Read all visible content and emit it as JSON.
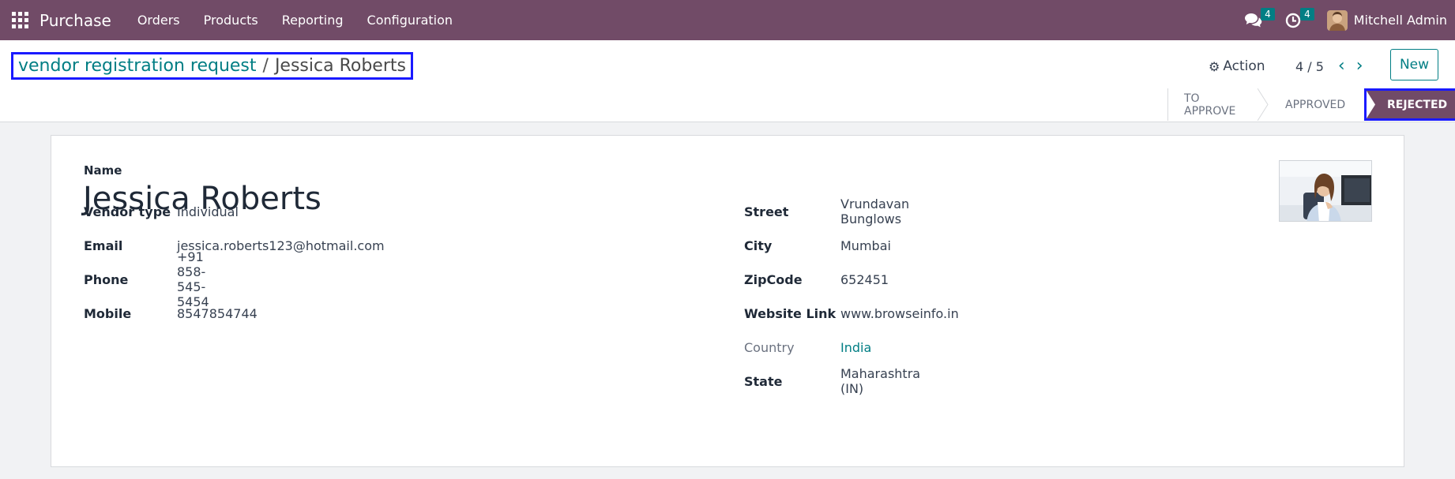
{
  "navbar": {
    "brand": "Purchase",
    "menu": [
      "Orders",
      "Products",
      "Reporting",
      "Configuration"
    ],
    "messages_count": "4",
    "activities_count": "4",
    "user_name": "Mitchell Admin"
  },
  "breadcrumb": {
    "parent": "vendor registration request",
    "separator": "/",
    "current": "Jessica Roberts"
  },
  "control_panel": {
    "action_label": "Action",
    "pager": "4 / 5",
    "new_label": "New"
  },
  "statusbar": {
    "stages": [
      "TO APPROVE",
      "APPROVED",
      "REJECTED"
    ],
    "active": "REJECTED"
  },
  "form": {
    "name_label": "Name",
    "name_value": "Jessica Roberts",
    "left_fields": [
      {
        "label": "Vendor type",
        "value": "Individual"
      },
      {
        "label": "Email",
        "value": "jessica.roberts123@hotmail.com"
      },
      {
        "label": "Phone",
        "value": "+91 858-545-5454"
      },
      {
        "label": "Mobile",
        "value": "8547854744"
      }
    ],
    "right_fields": [
      {
        "label": "Street",
        "value": "Vrundavan Bunglows"
      },
      {
        "label": "City",
        "value": "Mumbai"
      },
      {
        "label": "ZipCode",
        "value": "652451"
      },
      {
        "label": "Website Link",
        "value": "www.browseinfo.in"
      },
      {
        "label": "Country",
        "value": "India"
      },
      {
        "label": "State",
        "value": "Maharashtra (IN)"
      }
    ]
  },
  "colors": {
    "brand": "#714B67",
    "accent": "#017E84",
    "highlight_border": "#1a1aff"
  }
}
